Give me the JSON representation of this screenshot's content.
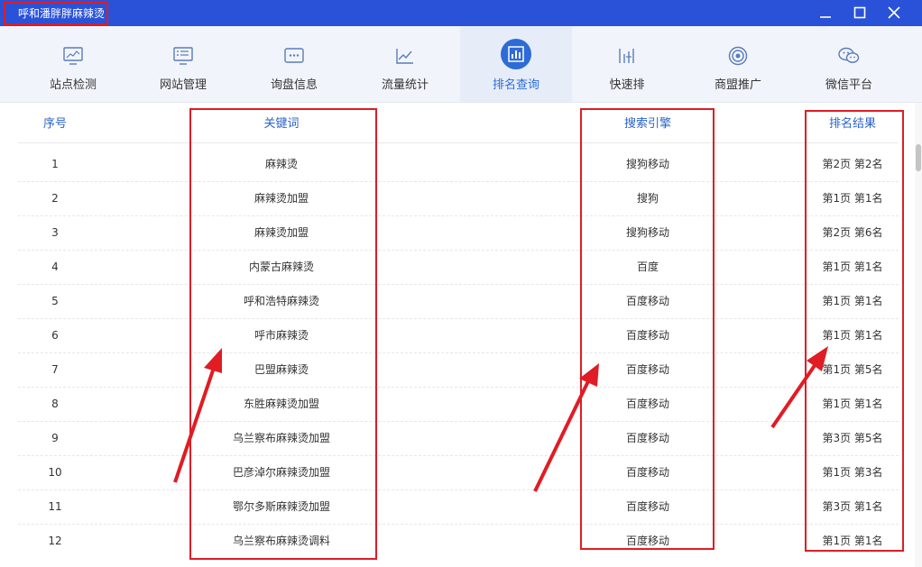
{
  "window": {
    "title": "呼和潘胖胖麻辣烫",
    "controls": [
      "minimize-icon",
      "maximize-icon",
      "close-icon"
    ]
  },
  "tabs": [
    {
      "label": "站点检测",
      "icon": "monitor-icon"
    },
    {
      "label": "网站管理",
      "icon": "website-icon"
    },
    {
      "label": "询盘信息",
      "icon": "message-icon"
    },
    {
      "label": "流量统计",
      "icon": "line-chart-icon"
    },
    {
      "label": "排名查询",
      "icon": "bar-chart-icon",
      "active": true
    },
    {
      "label": "快速排",
      "icon": "rank-bars-icon"
    },
    {
      "label": "商盟推广",
      "icon": "target-icon"
    },
    {
      "label": "微信平台",
      "icon": "wechat-icon"
    }
  ],
  "table": {
    "headers": {
      "index": "序号",
      "keyword": "关键词",
      "engine": "搜索引擎",
      "result": "排名结果"
    },
    "rows": [
      {
        "index": "1",
        "keyword": "麻辣烫",
        "engine": "搜狗移动",
        "result": "第2页 第2名"
      },
      {
        "index": "2",
        "keyword": "麻辣烫加盟",
        "engine": "搜狗",
        "result": "第1页 第1名"
      },
      {
        "index": "3",
        "keyword": "麻辣烫加盟",
        "engine": "搜狗移动",
        "result": "第2页 第6名"
      },
      {
        "index": "4",
        "keyword": "内蒙古麻辣烫",
        "engine": "百度",
        "result": "第1页 第1名"
      },
      {
        "index": "5",
        "keyword": "呼和浩特麻辣烫",
        "engine": "百度移动",
        "result": "第1页 第1名"
      },
      {
        "index": "6",
        "keyword": "呼市麻辣烫",
        "engine": "百度移动",
        "result": "第1页 第1名"
      },
      {
        "index": "7",
        "keyword": "巴盟麻辣烫",
        "engine": "百度移动",
        "result": "第1页 第5名"
      },
      {
        "index": "8",
        "keyword": "东胜麻辣烫加盟",
        "engine": "百度移动",
        "result": "第1页 第1名"
      },
      {
        "index": "9",
        "keyword": "乌兰察布麻辣烫加盟",
        "engine": "百度移动",
        "result": "第3页 第5名"
      },
      {
        "index": "10",
        "keyword": "巴彦淖尔麻辣烫加盟",
        "engine": "百度移动",
        "result": "第1页 第3名"
      },
      {
        "index": "11",
        "keyword": "鄂尔多斯麻辣烫加盟",
        "engine": "百度移动",
        "result": "第3页 第1名"
      },
      {
        "index": "12",
        "keyword": "乌兰察布麻辣烫调料",
        "engine": "百度移动",
        "result": "第1页 第1名"
      }
    ]
  },
  "colors": {
    "titlebar": "#2952d9",
    "accent": "#2d6bd7",
    "annotation": "#e01c24"
  }
}
